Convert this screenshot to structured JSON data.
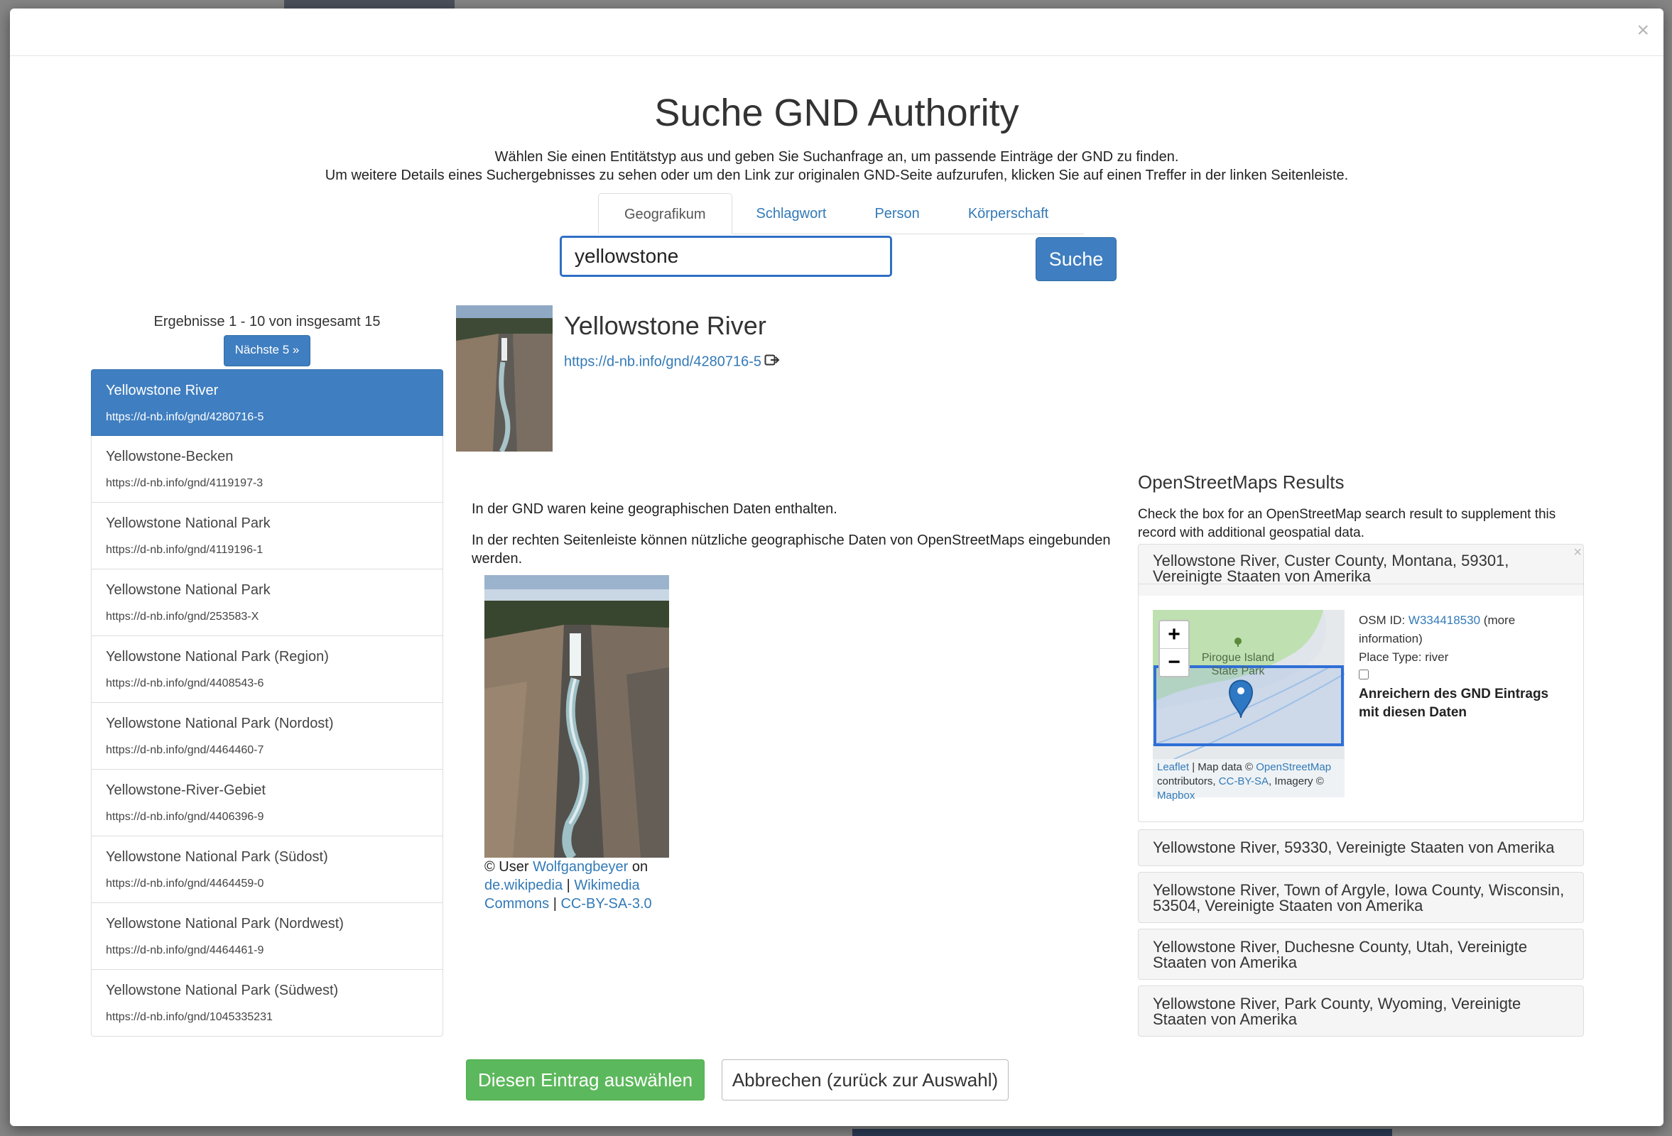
{
  "modal": {
    "close_label": "×",
    "title": "Suche GND Authority",
    "description_line1": "Wählen Sie einen Entitätstyp aus und geben Sie Suchanfrage an, um passende Einträge der GND zu finden.",
    "description_line2": "Um weitere Details eines Suchergebnisses zu sehen oder um den Link zur originalen GND-Seite aufzurufen, klicken Sie auf einen Treffer in der linken Seitenleiste."
  },
  "tabs": [
    {
      "label": "Geografikum",
      "active": true
    },
    {
      "label": "Schlagwort",
      "active": false
    },
    {
      "label": "Person",
      "active": false
    },
    {
      "label": "Körperschaft",
      "active": false
    }
  ],
  "search": {
    "value": "yellowstone",
    "button_label": "Suche"
  },
  "results": {
    "count_text": "Ergebnisse 1 - 10 von insgesamt 15",
    "next_label": "Nächste 5 »",
    "items": [
      {
        "label": "Yellowstone River",
        "url": "https://d-nb.info/gnd/4280716-5"
      },
      {
        "label": "Yellowstone-Becken",
        "url": "https://d-nb.info/gnd/4119197-3"
      },
      {
        "label": "Yellowstone National Park",
        "url": "https://d-nb.info/gnd/4119196-1"
      },
      {
        "label": "Yellowstone National Park",
        "url": "https://d-nb.info/gnd/253583-X"
      },
      {
        "label": "Yellowstone National Park (Region)",
        "url": "https://d-nb.info/gnd/4408543-6"
      },
      {
        "label": "Yellowstone National Park (Nordost)",
        "url": "https://d-nb.info/gnd/4464460-7"
      },
      {
        "label": "Yellowstone-River-Gebiet",
        "url": "https://d-nb.info/gnd/4406396-9"
      },
      {
        "label": "Yellowstone National Park (Südost)",
        "url": "https://d-nb.info/gnd/4464459-0"
      },
      {
        "label": "Yellowstone National Park (Nordwest)",
        "url": "https://d-nb.info/gnd/4464461-9"
      },
      {
        "label": "Yellowstone National Park (Südwest)",
        "url": "https://d-nb.info/gnd/1045335231"
      }
    ]
  },
  "detail": {
    "title": "Yellowstone River",
    "link": "https://d-nb.info/gnd/4280716-5",
    "no_geo_text": "In der GND waren keine geographischen Daten enthalten.",
    "sidebar_hint": "In der rechten Seitenleiste können nützliche geographische Daten von OpenStreetMaps eingebunden werden.",
    "credit": {
      "prefix": "© User",
      "user": "Wolfgangbeyer",
      "on": "on",
      "wiki": "de.wikipedia",
      "sep1": "|",
      "commons": "Wikimedia Commons",
      "sep2": "|",
      "license": "CC-BY-SA-3.0"
    }
  },
  "osm": {
    "title": "OpenStreetMaps Results",
    "description": "Check the box for an OpenStreetMap search result to supplement this record with additional geospatial data.",
    "first_result": {
      "title": "Yellowstone River, Custer County, Montana, 59301, Vereinigte Staaten von Amerika",
      "close_label": "×",
      "map_label": "Pirogue Island State Park",
      "zoom_in": "+",
      "zoom_out": "−",
      "attr_leaflet": "Leaflet",
      "attr_sep": "| Map data ©",
      "attr_osm": "OpenStreetMap",
      "attr_contrib": "contributors,",
      "attr_license": "CC-BY-SA",
      "attr_imagery": ", Imagery ©",
      "attr_mapbox": "Mapbox",
      "osm_id_label": "OSM ID:",
      "osm_id": "W334418530",
      "more_info": "(more information)",
      "place_type": "Place Type: river",
      "enrich_label": "Anreichern des GND Eintrags mit diesen Daten"
    },
    "other_results": [
      "Yellowstone River, 59330, Vereinigte Staaten von Amerika",
      "Yellowstone River, Town of Argyle, Iowa County, Wisconsin, 53504, Vereinigte Staaten von Amerika",
      "Yellowstone River, Duchesne County, Utah, Vereinigte Staaten von Amerika",
      "Yellowstone River, Park County, Wyoming, Vereinigte Staaten von Amerika"
    ]
  },
  "footer": {
    "select_label": "Diesen Eintrag auswählen",
    "cancel_label": "Abbrechen (zurück zur Auswahl)"
  },
  "colors": {
    "primary": "#3f7ec0",
    "success": "#5cb85c",
    "link": "#337ab7"
  }
}
